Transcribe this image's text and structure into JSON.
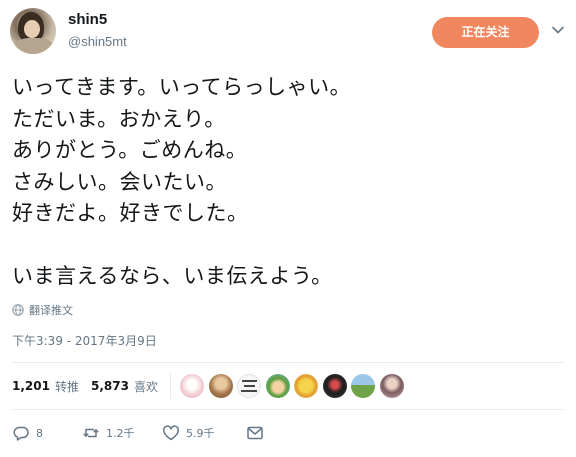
{
  "user": {
    "name": "shin5",
    "handle": "@shin5mt"
  },
  "follow_button": {
    "label": "正在关注"
  },
  "tweet": {
    "lines": [
      "いってきます。いってらっしゃい。",
      "ただいま。おかえり。",
      "ありがとう。ごめんね。",
      "さみしい。会いたい。",
      "好きだよ。好きでした。",
      "",
      "いま言えるなら、いま伝えよう。"
    ]
  },
  "translate": {
    "label": "翻译推文",
    "icon": "globe-icon"
  },
  "timestamp": "下午3:39 - 2017年3月9日",
  "stats": {
    "retweets": {
      "count": "1,201",
      "label": "转推"
    },
    "likes": {
      "count": "5,873",
      "label": "喜欢"
    }
  },
  "likers": [
    {
      "icon": "liker-avatar-1",
      "color": "#f3d4d8"
    },
    {
      "icon": "liker-avatar-2",
      "color": "#caa77a"
    },
    {
      "icon": "liker-avatar-3",
      "color": "#f4f4f4"
    },
    {
      "icon": "liker-avatar-4",
      "color": "#7fb7d8"
    },
    {
      "icon": "liker-avatar-5",
      "color": "#e9c64a"
    },
    {
      "icon": "liker-avatar-6",
      "color": "#2b2b2b"
    },
    {
      "icon": "liker-avatar-7",
      "color": "#5d8f3e"
    },
    {
      "icon": "liker-avatar-8",
      "color": "#8b6f74"
    }
  ],
  "actions": {
    "reply": {
      "count": "8",
      "icon": "reply-icon"
    },
    "retweet": {
      "count": "1.2千",
      "icon": "retweet-icon"
    },
    "like": {
      "count": "5.9千",
      "icon": "heart-icon"
    },
    "message": {
      "icon": "envelope-icon"
    }
  },
  "colors": {
    "follow_button": "#f0875f",
    "secondary_text": "#657786",
    "primary_text": "#14171a",
    "divider": "#e6ecf0"
  }
}
